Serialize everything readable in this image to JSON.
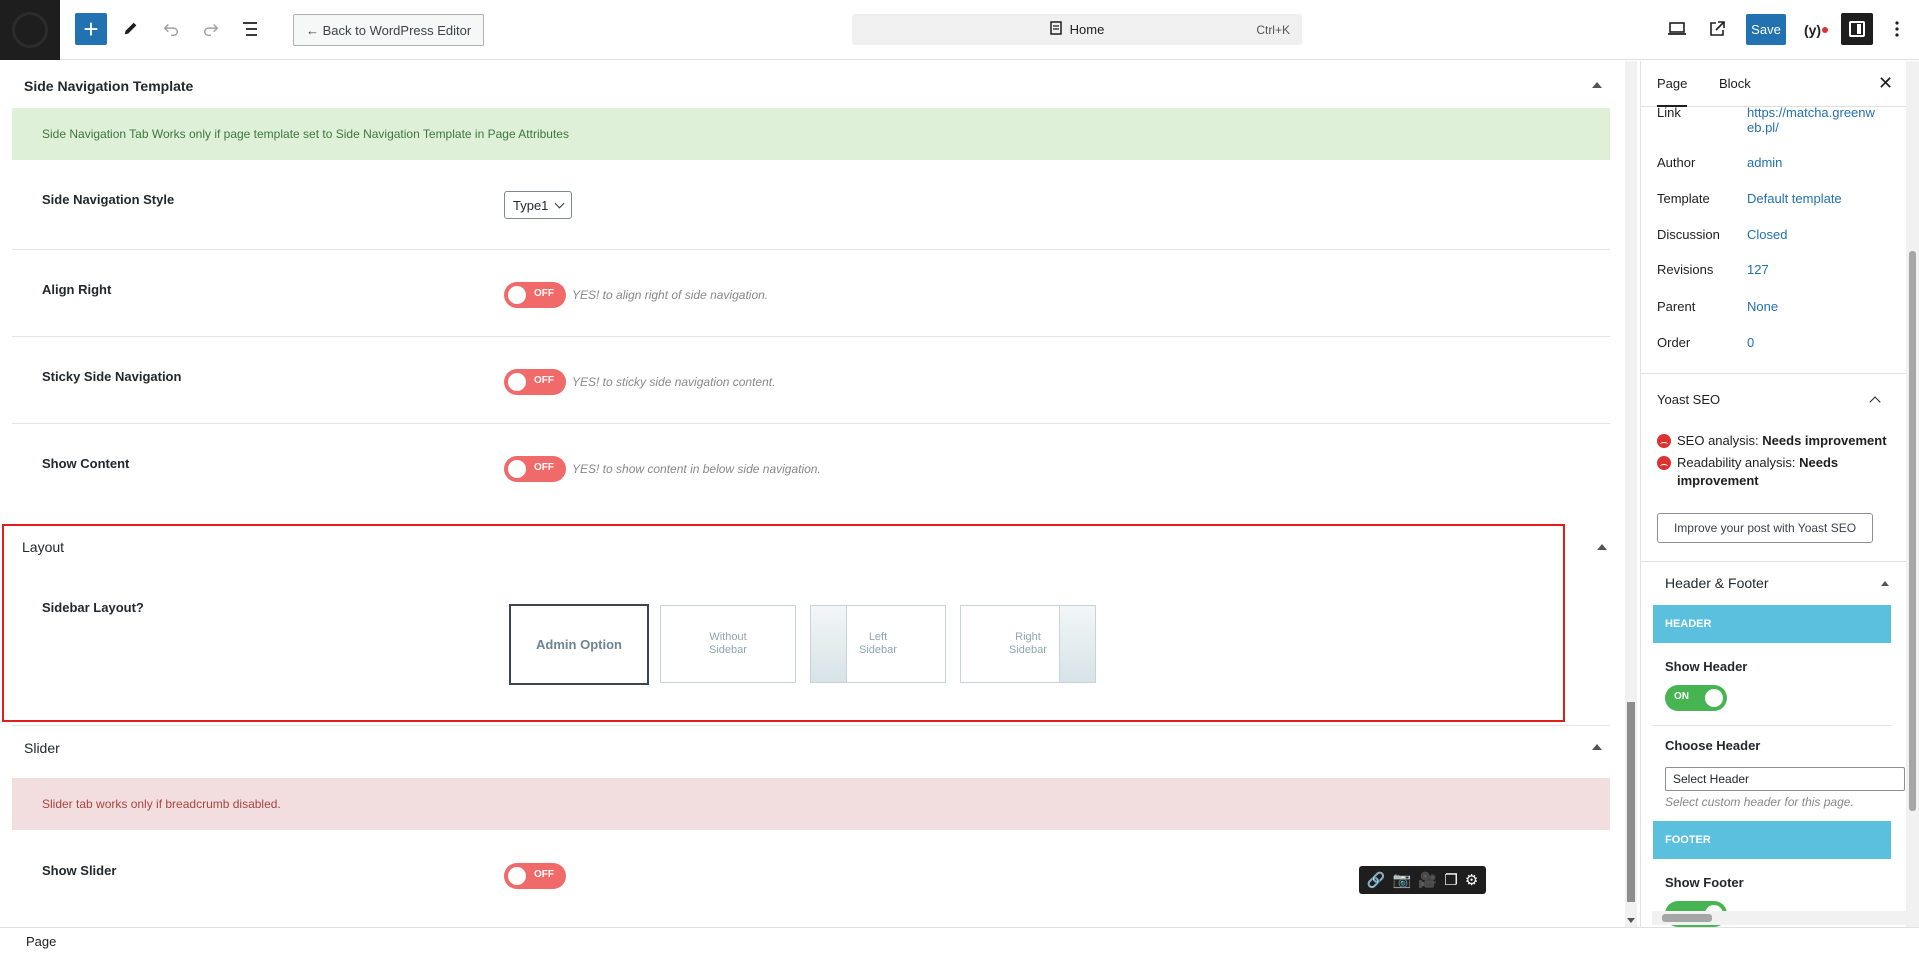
{
  "toolbar": {
    "back_label": "← Back to WordPress Editor",
    "command_title": "Home",
    "command_shortcut": "Ctrl+K",
    "save_label": "Save",
    "yoast_label": "(y)"
  },
  "main": {
    "side_nav": {
      "title": "Side Navigation Template",
      "notice": "Side Navigation Tab Works only if page template set to Side Navigation Template in Page Attributes",
      "rows": [
        {
          "label": "Side Navigation Style",
          "select_value": "Type1"
        },
        {
          "label": "Align Right",
          "toggle": "OFF",
          "hint": "YES! to align right of side navigation."
        },
        {
          "label": "Sticky Side Navigation",
          "toggle": "OFF",
          "hint": "YES! to sticky side navigation content."
        },
        {
          "label": "Show Content",
          "toggle": "OFF",
          "hint": "YES! to show content in below side navigation."
        }
      ]
    },
    "layout": {
      "title": "Layout",
      "label": "Sidebar Layout?",
      "options": [
        {
          "label": "Admin Option",
          "selected": true
        },
        {
          "label": "Without Sidebar",
          "selected": false
        },
        {
          "label": "Left Sidebar",
          "selected": false
        },
        {
          "label": "Right Sidebar",
          "selected": false
        }
      ]
    },
    "slider": {
      "title": "Slider",
      "notice": "Slider tab works only if breadcrumb disabled.",
      "row": {
        "label": "Show Slider",
        "toggle": "OFF"
      }
    }
  },
  "sidebar": {
    "tabs": [
      "Page",
      "Block"
    ],
    "meta": [
      {
        "key": "Link",
        "value": "https://matcha.greenweb.pl/"
      },
      {
        "key": "Author",
        "value": "admin"
      },
      {
        "key": "Template",
        "value": "Default template"
      },
      {
        "key": "Discussion",
        "value": "Closed"
      },
      {
        "key": "Revisions",
        "value": "127"
      },
      {
        "key": "Parent",
        "value": "None"
      },
      {
        "key": "Order",
        "value": "0"
      }
    ],
    "yoast": {
      "title": "Yoast SEO",
      "seo_label": "SEO analysis:",
      "seo_value": "Needs improvement",
      "read_label": "Readability analysis:",
      "read_value": "Needs improvement",
      "improve_button": "Improve your post with Yoast SEO"
    },
    "header_footer": {
      "title": "Header & Footer",
      "header_band": "HEADER",
      "show_header": "Show Header",
      "show_header_toggle": "ON",
      "choose_header": "Choose Header",
      "select_header_value": "Select Header",
      "select_header_hint": "Select custom header for this page.",
      "footer_band": "FOOTER",
      "show_footer": "Show Footer"
    }
  },
  "footer": {
    "breadcrumb": "Page"
  },
  "colors": {
    "accent": "#2271b1",
    "toggle_off": "#f06a6a",
    "toggle_on": "#46b450",
    "band": "#5bc0de",
    "highlight_border": "#e01e1e"
  }
}
